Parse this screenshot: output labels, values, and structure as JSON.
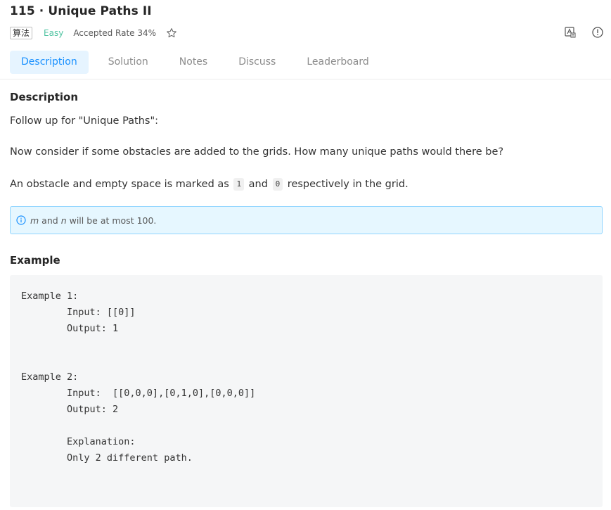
{
  "problem": {
    "title": "115 · Unique Paths II",
    "tag": "算法",
    "difficulty": "Easy",
    "accepted_rate": "Accepted Rate 34%"
  },
  "icons": {
    "star": "star-outline-icon",
    "translate": "translate-icon",
    "info": "info-circle-icon"
  },
  "tabs": [
    {
      "label": "Description",
      "active": true
    },
    {
      "label": "Solution",
      "active": false
    },
    {
      "label": "Notes",
      "active": false
    },
    {
      "label": "Discuss",
      "active": false
    },
    {
      "label": "Leaderboard",
      "active": false
    }
  ],
  "description": {
    "heading": "Description",
    "paragraph1": "Follow up for \"Unique Paths\":",
    "paragraph2": "Now consider if some obstacles are added to the grids. How many unique paths would there be?",
    "paragraph3": {
      "prefix": "An obstacle and empty space is marked as",
      "code1": "1",
      "middle": "and",
      "code2": "0",
      "suffix": "respectively in the grid."
    },
    "note": {
      "var1": "m",
      "mid": "and",
      "var2": "n",
      "rest": "will be at most 100."
    }
  },
  "example": {
    "heading": "Example",
    "code": "Example 1:\n        Input: [[0]]\n        Output: 1\n\n\nExample 2:\n        Input:  [[0,0,0],[0,1,0],[0,0,0]]\n        Output: 2\n\n        Explanation:\n        Only 2 different path."
  },
  "colors": {
    "accent": "#1890ff",
    "easy": "#4fc3a1",
    "tab_active_bg": "#e6f4ff",
    "note_bg": "#e6f7ff",
    "note_border": "#91d5ff",
    "code_bg": "#f5f6f7"
  }
}
